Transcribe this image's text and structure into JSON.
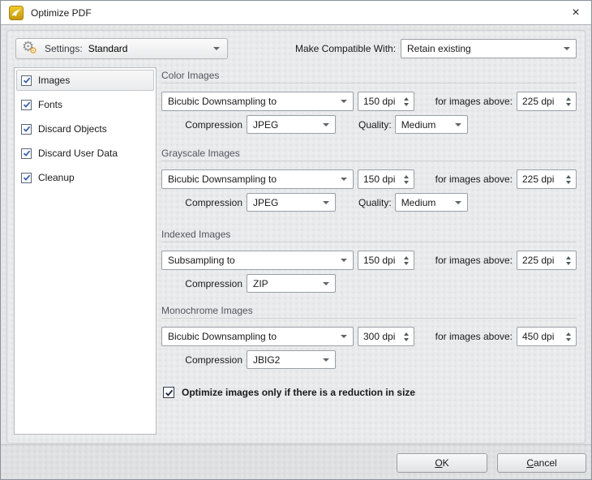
{
  "window": {
    "title": "Optimize PDF",
    "close_glyph": "×"
  },
  "icons": {
    "app": "pdf-xchange-swoosh",
    "settings": "gears",
    "dropdown": "chevron-down-triangle",
    "spinner": "up-down-triangles",
    "check": "checkmark"
  },
  "toolbar": {
    "settings_label": "Settings:",
    "settings_value": "Standard",
    "compat_label": "Make Compatible With:",
    "compat_value": "Retain existing"
  },
  "sidebar": {
    "items": [
      {
        "label": "Images",
        "checked": true,
        "selected": true
      },
      {
        "label": "Fonts",
        "checked": true,
        "selected": false
      },
      {
        "label": "Discard Objects",
        "checked": true,
        "selected": false
      },
      {
        "label": "Discard User Data",
        "checked": true,
        "selected": false
      },
      {
        "label": "Cleanup",
        "checked": true,
        "selected": false
      }
    ]
  },
  "content": {
    "sections": [
      {
        "title": "Color Images",
        "downsample": "Bicubic Downsampling to",
        "dpi": "150 dpi",
        "above_label": "for images above:",
        "above_dpi": "225 dpi",
        "compression_label": "Compression",
        "compression": "JPEG",
        "quality_label": "Quality:",
        "quality": "Medium"
      },
      {
        "title": "Grayscale Images",
        "downsample": "Bicubic Downsampling to",
        "dpi": "150 dpi",
        "above_label": "for images above:",
        "above_dpi": "225 dpi",
        "compression_label": "Compression",
        "compression": "JPEG",
        "quality_label": "Quality:",
        "quality": "Medium"
      },
      {
        "title": "Indexed Images",
        "downsample": "Subsampling to",
        "dpi": "150 dpi",
        "above_label": "for images above:",
        "above_dpi": "225 dpi",
        "compression_label": "Compression",
        "compression": "ZIP"
      },
      {
        "title": "Monochrome Images",
        "downsample": "Bicubic Downsampling to",
        "dpi": "300 dpi",
        "above_label": "for images above:",
        "above_dpi": "450 dpi",
        "compression_label": "Compression",
        "compression": "JBIG2"
      }
    ],
    "optimize_checkbox_label": "Optimize images only if there is a reduction in size"
  },
  "footer": {
    "ok_label": "OK",
    "cancel_label": "Cancel"
  },
  "colors": {
    "accent_gold": "#e2ae10",
    "check_blue": "#3a62a8",
    "check_dark": "#24314a",
    "section_header_text": "#55555f",
    "panel_bg": "#e9eaec",
    "footer_bg": "#dee0e2"
  }
}
